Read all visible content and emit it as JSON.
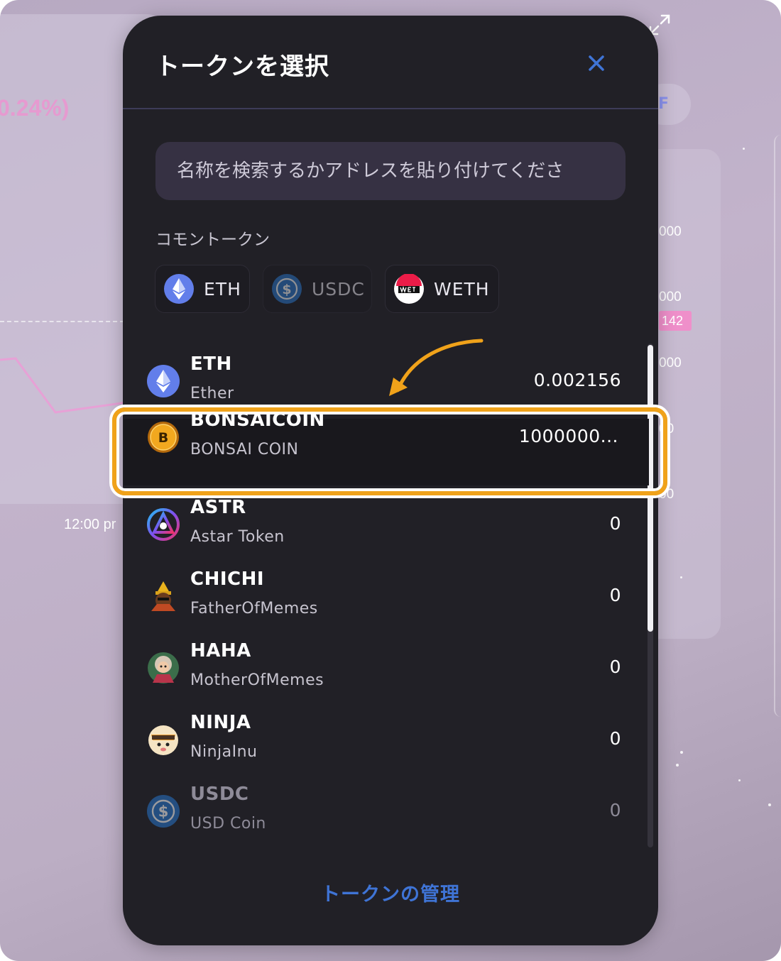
{
  "background": {
    "percent_text": "0.24%)",
    "time_label": "12:00 pr",
    "axis_labels": [
      "000",
      "000",
      "000",
      "00",
      "00"
    ],
    "axis_badge": "142",
    "pill_text": "F"
  },
  "modal": {
    "title": "トークンを選択",
    "close_icon": "close-icon",
    "search": {
      "placeholder": "名称を検索するかアドレスを貼り付けてくださ"
    },
    "common_tokens_label": "コモントークン",
    "common_tokens": [
      {
        "symbol": "ETH",
        "icon": "eth-icon"
      },
      {
        "symbol": "USDC",
        "icon": "usdc-icon"
      },
      {
        "symbol": "WETH",
        "icon": "weth-icon"
      }
    ],
    "tokens": [
      {
        "symbol": "ETH",
        "name": "Ether",
        "balance": "0.002156",
        "icon": "eth-icon"
      },
      {
        "symbol": "BONSAICOIN",
        "name": "BONSAI COIN",
        "balance": "1000000...",
        "icon": "bonsaicoin-icon"
      },
      {
        "symbol": "ASTR",
        "name": "Astar Token",
        "balance": "0",
        "icon": "astar-icon"
      },
      {
        "symbol": "CHICHI",
        "name": "FatherOfMemes",
        "balance": "0",
        "icon": "chichi-icon"
      },
      {
        "symbol": "HAHA",
        "name": "MotherOfMemes",
        "balance": "0",
        "icon": "haha-icon"
      },
      {
        "symbol": "NINJA",
        "name": "NinjaInu",
        "balance": "0",
        "icon": "ninja-icon"
      },
      {
        "symbol": "USDC",
        "name": "USD Coin",
        "balance": "0",
        "icon": "usdc-icon"
      }
    ],
    "manage_link": "トークンの管理"
  },
  "colors": {
    "modal_bg": "#212026",
    "accent_blue": "#3f74d6",
    "highlight_orange": "#f0a21a"
  }
}
